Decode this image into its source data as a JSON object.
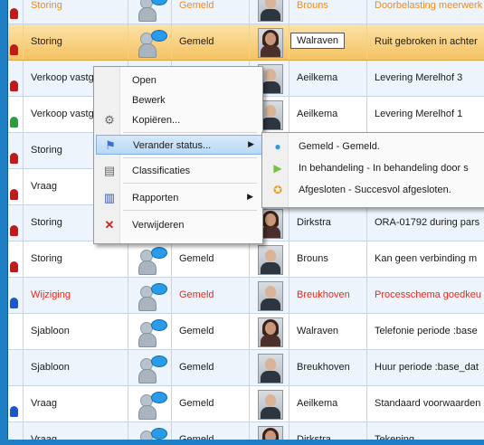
{
  "rows": [
    {
      "type": "Storing",
      "status": "Gemeld",
      "person": "Brouns",
      "desc": "Doorbelasting meerwerk",
      "tone": "orange",
      "flag": "red",
      "avatar": "m"
    },
    {
      "type": "Storing",
      "status": "Gemeld",
      "person": "Walraven",
      "desc": "Ruit gebroken in achter",
      "tone": "normal",
      "flag": "red",
      "avatar": "f"
    },
    {
      "type": "Verkoop vastgoed",
      "status": "",
      "person": "Aeilkema",
      "desc": "Levering Merelhof 3",
      "tone": "normal",
      "flag": "red",
      "avatar": "m"
    },
    {
      "type": "Verkoop vastgoed",
      "status": "",
      "person": "Aeilkema",
      "desc": "Levering Merelhof 1",
      "tone": "normal",
      "flag": "green",
      "avatar": "m"
    },
    {
      "type": "Storing",
      "status": "",
      "person": "",
      "desc": "",
      "tone": "normal",
      "flag": "red",
      "avatar": "m"
    },
    {
      "type": "Vraag",
      "status": "",
      "person": "",
      "desc": "",
      "tone": "normal",
      "flag": "red",
      "avatar": "m"
    },
    {
      "type": "Storing",
      "status": "",
      "person": "Dirkstra",
      "desc": "ORA-01792 during pars",
      "tone": "normal",
      "flag": "red",
      "avatar": "f"
    },
    {
      "type": "Storing",
      "status": "Gemeld",
      "person": "Brouns",
      "desc": "Kan geen verbinding m",
      "tone": "normal",
      "flag": "red",
      "avatar": "m"
    },
    {
      "type": "Wijziging",
      "status": "Gemeld",
      "person": "Breukhoven",
      "desc": "Processchema goedkeu",
      "tone": "red",
      "flag": "blue",
      "avatar": "m"
    },
    {
      "type": "Sjabloon",
      "status": "Gemeld",
      "person": "Walraven",
      "desc": "Telefonie periode :base",
      "tone": "normal",
      "flag": "none",
      "avatar": "f"
    },
    {
      "type": "Sjabloon",
      "status": "Gemeld",
      "person": "Breukhoven",
      "desc": "Huur periode :base_dat",
      "tone": "normal",
      "flag": "none",
      "avatar": "m"
    },
    {
      "type": "Vraag",
      "status": "Gemeld",
      "person": "Aeilkema",
      "desc": "Standaard voorwaarden",
      "tone": "normal",
      "flag": "blue",
      "avatar": "m"
    },
    {
      "type": "Vraag",
      "status": "Gemeld",
      "person": "Dirkstra",
      "desc": "Tekening",
      "tone": "normal",
      "flag": "blue",
      "avatar": "f"
    }
  ],
  "context_menu": {
    "items": [
      {
        "label": "Open",
        "icon": ""
      },
      {
        "label": "Bewerk",
        "icon": ""
      },
      {
        "label": "Kopiëren...",
        "icon": "copy-icon"
      },
      {
        "label": "Verander status...",
        "icon": "flag-icon",
        "submenu": true
      },
      {
        "label": "Classificaties",
        "icon": "tag-icon"
      },
      {
        "label": "Rapporten",
        "icon": "report-icon",
        "submenu": true
      },
      {
        "label": "Verwijderen",
        "icon": "delete-icon"
      }
    ]
  },
  "status_submenu": {
    "items": [
      {
        "label": "Gemeld - Gemeld.",
        "icon": "person-bubble-icon"
      },
      {
        "label": "In behandeling - In behandeling door s",
        "icon": "play-icon"
      },
      {
        "label": "Afgesloten - Succesvol afgesloten.",
        "icon": "award-icon"
      }
    ]
  },
  "colors": {
    "selected_row": "#f5c262",
    "accent_red": "#e8281e",
    "accent_orange": "#f08a1d",
    "frame": "#1f7fc4"
  }
}
